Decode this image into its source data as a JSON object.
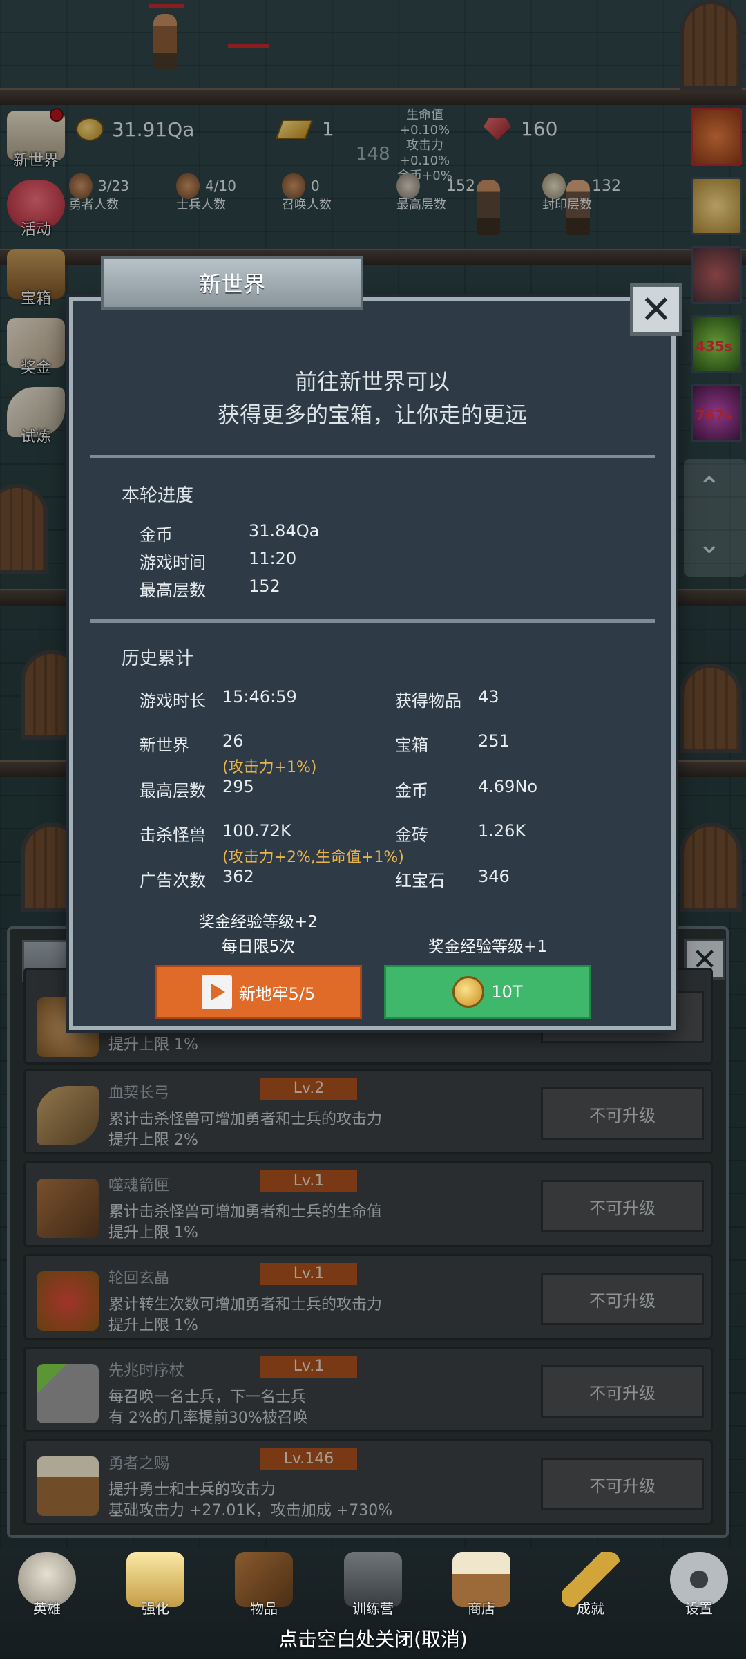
{
  "topbar": {
    "coins": "31.91Qa",
    "gold_bars": "1",
    "bonus_lines": [
      "生命值+0.10%",
      "攻击力+0.10%",
      "金币+0%"
    ],
    "rubies": "160",
    "floor_marker": "148",
    "stats": [
      {
        "value": "3/23",
        "label": "勇者人数"
      },
      {
        "value": "4/10",
        "label": "士兵人数"
      },
      {
        "value": "0",
        "label": "召唤人数"
      },
      {
        "value": "152",
        "label": "最高层数"
      },
      {
        "value": "132",
        "label": "封印层数"
      }
    ]
  },
  "left_menu": [
    "新世界",
    "活动",
    "宝箱",
    "奖金",
    "试炼"
  ],
  "right_menu": {
    "timer1": "435s",
    "timer2": "767s"
  },
  "modal": {
    "title": "新世界",
    "intro_line1": "前往新世界可以",
    "intro_line2": "获得更多的宝箱，让你走的更远",
    "round_title": "本轮进度",
    "round": [
      {
        "k": "金币",
        "v": "31.84Qa"
      },
      {
        "k": "游戏时间",
        "v": "11:20"
      },
      {
        "k": "最高层数",
        "v": "152"
      }
    ],
    "history_title": "历史累计",
    "history": {
      "play_time_k": "游戏时长",
      "play_time_v": "15:46:59",
      "items_k": "获得物品",
      "items_v": "43",
      "newworld_k": "新世界",
      "newworld_v": "26",
      "newworld_note": "(攻击力+1%)",
      "chest_k": "宝箱",
      "chest_v": "251",
      "maxfloor_k": "最高层数",
      "maxfloor_v": "295",
      "gold_k": "金币",
      "gold_v": "4.69No",
      "kills_k": "击杀怪兽",
      "kills_v": "100.72K",
      "kills_note": "(攻击力+2%,生命值+1%)",
      "bricks_k": "金砖",
      "bricks_v": "1.26K",
      "ads_k": "广告次数",
      "ads_v": "362",
      "ruby_k": "红宝石",
      "ruby_v": "346"
    },
    "left_bonus_line1": "奖金经验等级+2",
    "left_bonus_line2": "每日限5次",
    "right_bonus": "奖金经验等级+1",
    "btn_ad_label": "新地牢5/5",
    "btn_coin_label": "10T"
  },
  "list": {
    "partial_desc": "提升上限 1%",
    "rows": [
      {
        "name": "血契长弓",
        "lv": "Lv.2",
        "desc1": "累计击杀怪兽可增加勇者和士兵的攻击力",
        "desc2": "提升上限 2%",
        "btn": "不可升级"
      },
      {
        "name": "噬魂箭匣",
        "lv": "Lv.1",
        "desc1": "累计击杀怪兽可增加勇者和士兵的生命值",
        "desc2": "提升上限 1%",
        "btn": "不可升级"
      },
      {
        "name": "轮回玄晶",
        "lv": "Lv.1",
        "desc1": "累计转生次数可增加勇者和士兵的攻击力",
        "desc2": "提升上限 1%",
        "btn": "不可升级"
      },
      {
        "name": "先兆时序杖",
        "lv": "Lv.1",
        "desc1": "每召唤一名士兵，下一名士兵",
        "desc2": "有 2%的几率提前30%被召唤",
        "btn": "不可升级"
      },
      {
        "name": "勇者之赐",
        "lv": "Lv.146",
        "desc1": "提升勇士和士兵的攻击力",
        "desc2": "基础攻击力 +27.01K，攻击加成 +730%",
        "btn": "不可升级"
      }
    ]
  },
  "bottom_nav": [
    "英雄",
    "强化",
    "物品",
    "训练营",
    "商店",
    "成就",
    "设置"
  ],
  "hint": "点击空白处关闭(取消)",
  "colors": {
    "orange": "#e06a28",
    "green": "#3fb86b",
    "note": "#e8b44a",
    "level": "#a8501c"
  }
}
